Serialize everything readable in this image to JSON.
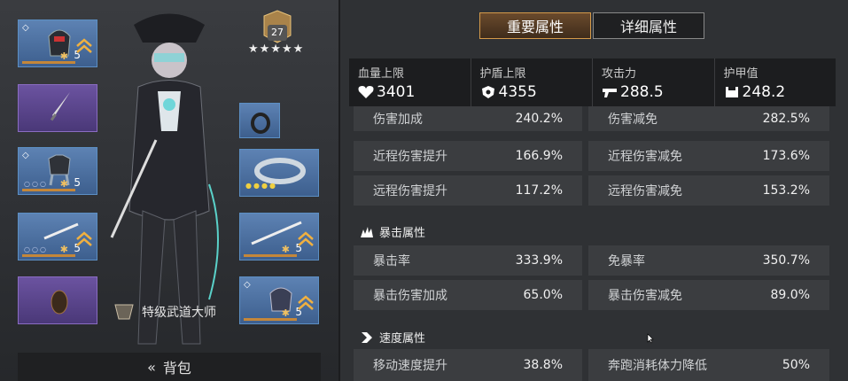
{
  "left": {
    "level": "27",
    "stars": "★★★★★",
    "slots": [
      {
        "lvl": "5",
        "diamond": "◇"
      },
      {
        "lvl": ""
      },
      {
        "lvl": "5",
        "diamond": "◇",
        "dots": "○○○"
      },
      {
        "lvl": "5",
        "dots": "○○○"
      },
      {
        "lvl": "5"
      },
      {
        "lvl": "5",
        "dots": "○○○"
      },
      {
        "lvl": "5",
        "diamond": "◇"
      }
    ],
    "title": "特级武道大师",
    "bag_label": "背包"
  },
  "tabs": {
    "important": "重要属性",
    "detail": "详细属性"
  },
  "summary": [
    {
      "label": "血量上限",
      "value": "3401",
      "icon": "heart-icon"
    },
    {
      "label": "护盾上限",
      "value": "4355",
      "icon": "shield-icon"
    },
    {
      "label": "攻击力",
      "value": "288.5",
      "icon": "gun-icon"
    },
    {
      "label": "护甲值",
      "value": "248.2",
      "icon": "armor-icon"
    }
  ],
  "rows": [
    {
      "n1": "伤害加成",
      "v1": "240.2%",
      "n2": "伤害减免",
      "v2": "282.5%"
    },
    {
      "n1": "近程伤害提升",
      "v1": "166.9%",
      "n2": "近程伤害减免",
      "v2": "173.6%"
    },
    {
      "n1": "远程伤害提升",
      "v1": "117.2%",
      "n2": "远程伤害减免",
      "v2": "153.2%"
    }
  ],
  "crit_section": "暴击属性",
  "crit_rows": [
    {
      "n1": "暴击率",
      "v1": "333.9%",
      "n2": "免暴率",
      "v2": "350.7%"
    },
    {
      "n1": "暴击伤害加成",
      "v1": "65.0%",
      "n2": "暴击伤害减免",
      "v2": "89.0%"
    }
  ],
  "speed_section": "速度属性",
  "speed_rows": [
    {
      "n1": "移动速度提升",
      "v1": "38.8%",
      "n2": "奔跑消耗体力降低",
      "v2": "50%"
    }
  ]
}
